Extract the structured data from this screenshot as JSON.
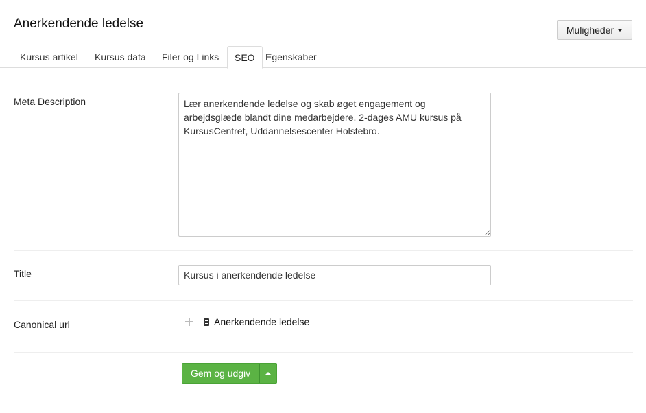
{
  "header": {
    "title": "Anerkendende ledelse",
    "options_label": "Muligheder"
  },
  "tabs": [
    {
      "label": "Kursus artikel",
      "active": false
    },
    {
      "label": "Kursus data",
      "active": false
    },
    {
      "label": "Filer og Links",
      "active": false
    },
    {
      "label": "SEO",
      "active": true
    },
    {
      "label": "Egenskaber",
      "active": false
    }
  ],
  "form": {
    "meta_description": {
      "label": "Meta Description",
      "value": "Lær anerkendende ledelse og skab øget engagement og arbejdsglæde blandt dine medarbejdere. 2-dages AMU kursus på KursusCentret, Uddannelsescenter Holstebro."
    },
    "title": {
      "label": "Title",
      "value": "Kursus i anerkendende ledelse"
    },
    "canonical_url": {
      "label": "Canonical url",
      "link_text": "Anerkendende ledelse"
    }
  },
  "actions": {
    "save_label": "Gem og udgiv"
  },
  "colors": {
    "save_button": "#5bb344",
    "border": "#cccccc",
    "divider": "#eeeeee"
  }
}
